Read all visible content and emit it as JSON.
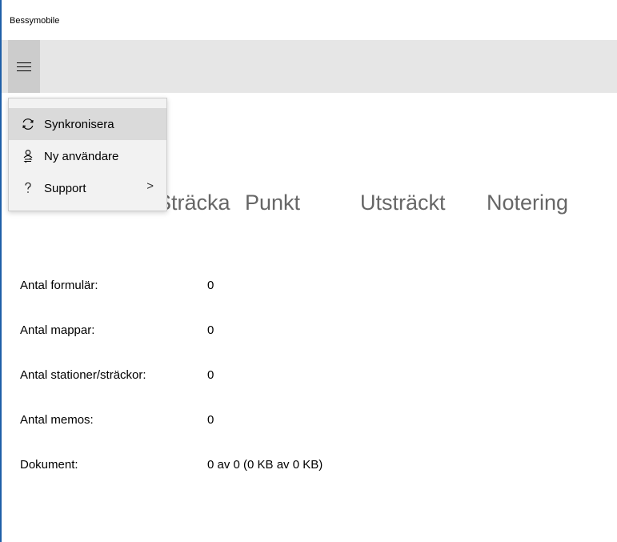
{
  "window": {
    "title": "Bessymobile"
  },
  "menu": {
    "items": [
      {
        "label": "Synkronisera",
        "icon": "sync-icon"
      },
      {
        "label": "Ny användare",
        "icon": "switch-user-icon"
      },
      {
        "label": "Support",
        "icon": "question-icon",
        "submenu_glyph": ">"
      }
    ]
  },
  "pivot": {
    "items": [
      {
        "label": "Sträcka"
      },
      {
        "label": "Punkt"
      },
      {
        "label": "Utsträckt"
      },
      {
        "label": "Notering"
      }
    ]
  },
  "stats": {
    "rows": [
      {
        "label": "Antal formulär:",
        "value": "0"
      },
      {
        "label": "Antal mappar:",
        "value": "0"
      },
      {
        "label": "Antal stationer/sträckor:",
        "value": "0"
      },
      {
        "label": "Antal memos:",
        "value": "0"
      },
      {
        "label": "Dokument:",
        "value": "0 av 0 (0 KB av 0 KB)"
      }
    ]
  },
  "colors": {
    "accent_border": "#1e5fa8",
    "command_bar": "#e6e6e6",
    "menu_background": "#f2f2f2",
    "menu_hover": "#dadada",
    "pivot_text": "#666666"
  }
}
